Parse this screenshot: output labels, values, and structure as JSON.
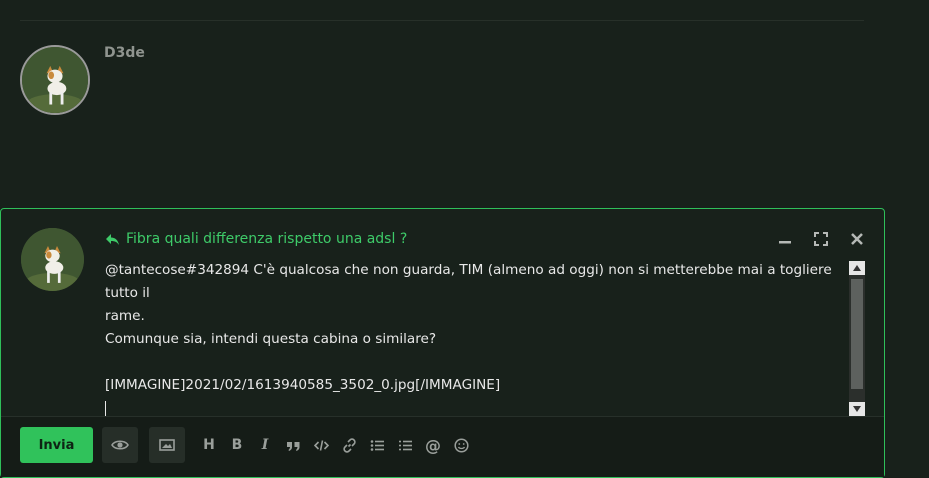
{
  "post": {
    "username": "D3de"
  },
  "editor": {
    "reply_title": "Fibra quali differenza rispetto una adsl ?",
    "lines": [
      "@tantecose#342894 C'è qualcosa che non guarda, TIM (almeno ad oggi) non si metterebbe mai a togliere tutto il",
      "rame.",
      "Comunque sia, intendi questa cabina o similare?",
      "",
      "[IMMAGINE]2021/02/1613940585_3502_0.jpg[/IMMAGINE]",
      ""
    ],
    "send_label": "Invia",
    "heading_label": "H",
    "bold_label": "B",
    "italic_label": "I",
    "mention_label": "@"
  },
  "colors": {
    "background": "#18211b",
    "accent": "#30c25b",
    "accent_text": "#3ecb69",
    "icon": "#9a9f9b"
  }
}
